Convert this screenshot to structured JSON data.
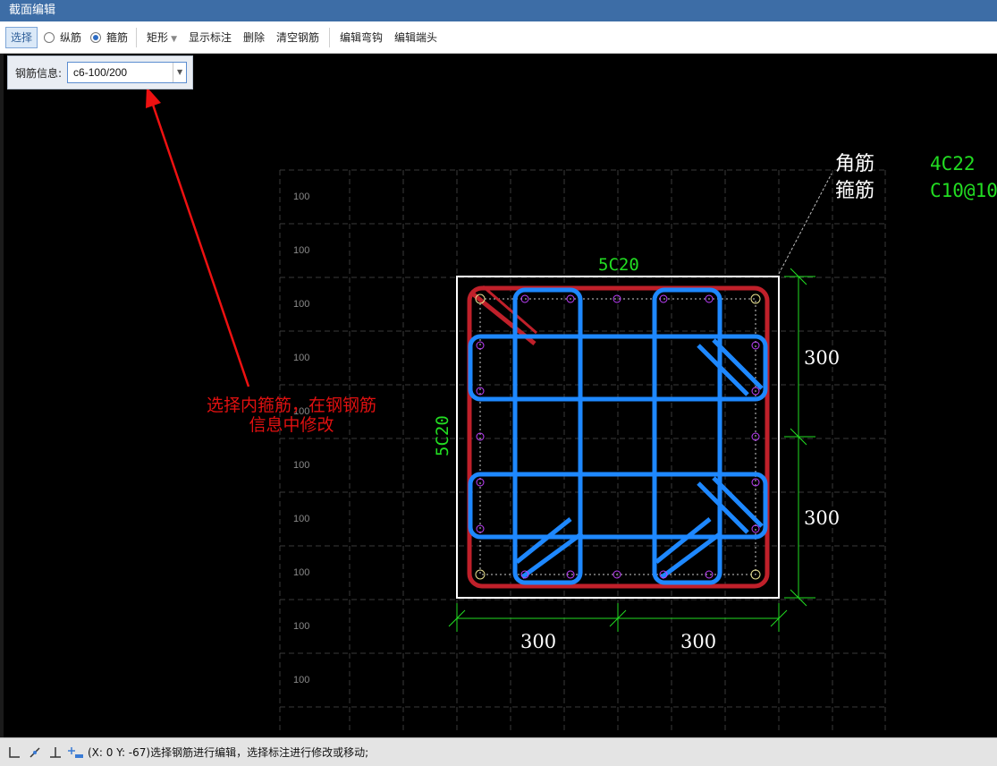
{
  "window": {
    "title": "截面编辑"
  },
  "toolbar": {
    "select_label": "选择",
    "longitudinal_label": "纵筋",
    "stirrup_label": "箍筋",
    "shape_label": "矩形",
    "show_annotation_label": "显示标注",
    "delete_label": "删除",
    "clear_label": "清空钢筋",
    "edit_hook_label": "编辑弯钩",
    "edit_end_label": "编辑端头",
    "selected_radio": "stirrup"
  },
  "rebar_info": {
    "label": "钢筋信息:",
    "value": "c6-100/200"
  },
  "drawing": {
    "grid_labels": [
      "100",
      "100",
      "100",
      "100",
      "100",
      "100",
      "100",
      "100",
      "100",
      "100"
    ],
    "top_label": "5C20",
    "left_label": "5C20",
    "right_dims": [
      "300",
      "300"
    ],
    "bottom_dims": [
      "300",
      "300"
    ],
    "legend_corner_name": "角筋",
    "legend_corner_value": "4C22",
    "legend_stirrup_name": "箍筋",
    "legend_stirrup_value": "C10@10",
    "annotation_line1": "选择内箍筋，在钢钢筋",
    "annotation_line2": "信息中修改"
  },
  "colors": {
    "outer_stirrup": "#c0202a",
    "inner_stirrup": "#1e88ff",
    "dimension": "#22dd22",
    "annotation": "#e01010",
    "grid": "#3a3a3a"
  },
  "status": {
    "text": "(X: 0 Y: -67)选择钢筋进行编辑，选择标注进行修改或移动;"
  }
}
